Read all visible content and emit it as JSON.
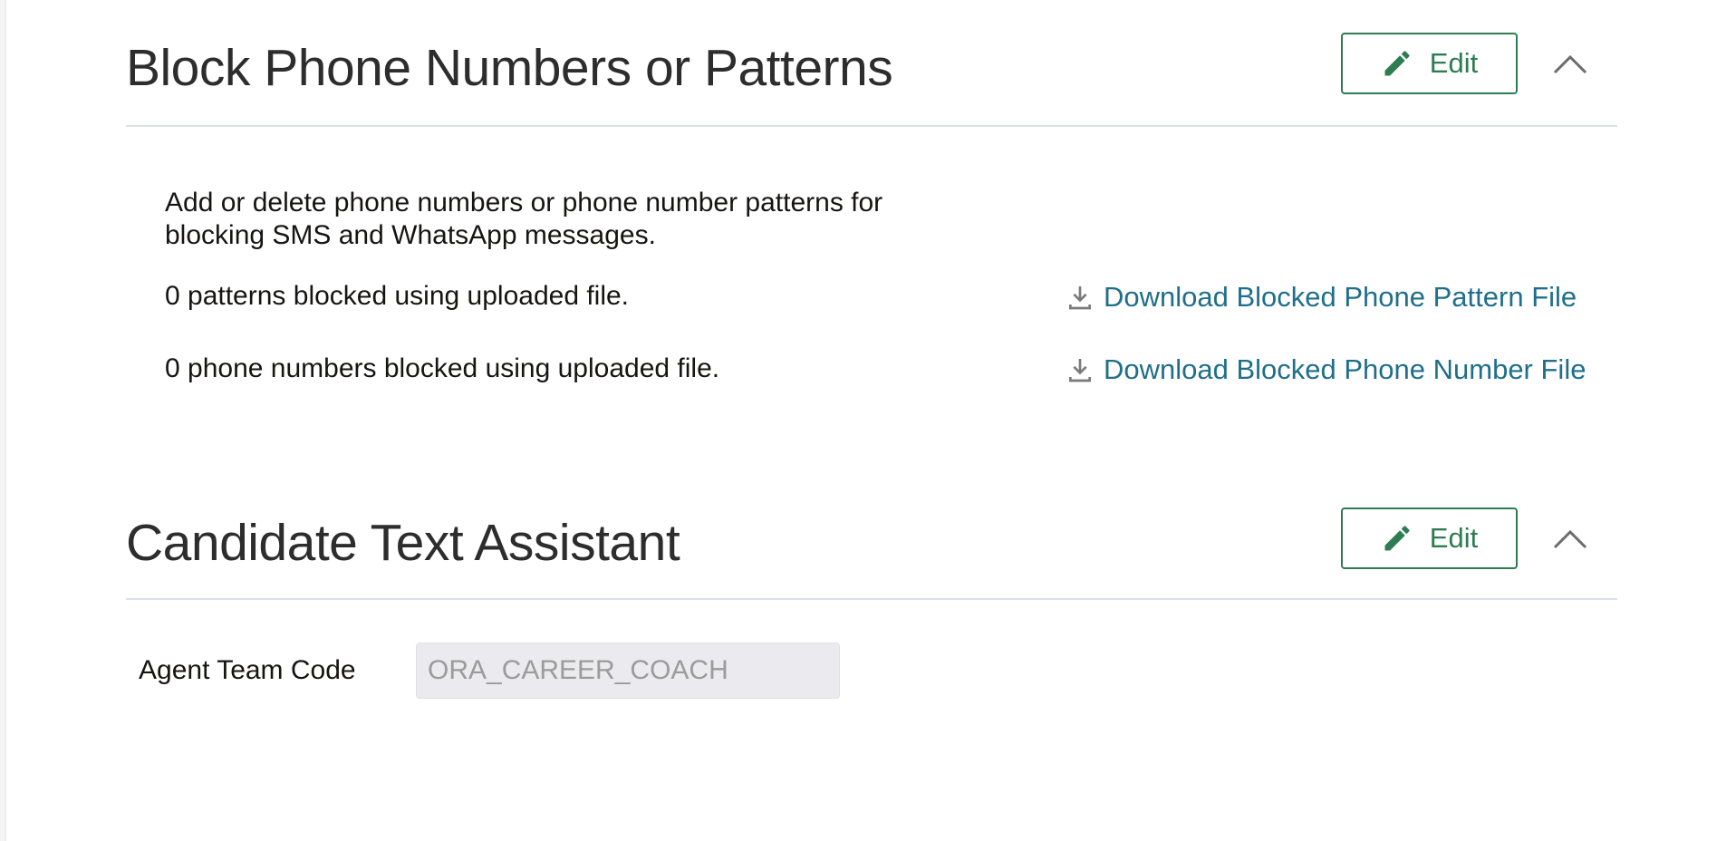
{
  "sections": {
    "block": {
      "title": "Block Phone Numbers or Patterns",
      "edit_label": "Edit",
      "description_line1": "Add or delete phone numbers or phone number patterns for",
      "description_line2": "blocking SMS and WhatsApp messages.",
      "patterns_status": "0 patterns blocked using uploaded file.",
      "numbers_status": "0 phone numbers blocked using uploaded file.",
      "download_pattern_label": "Download Blocked Phone Pattern File",
      "download_number_label": "Download Blocked Phone Number File"
    },
    "assistant": {
      "title": "Candidate Text Assistant",
      "edit_label": "Edit",
      "agent_team_code_label": "Agent Team Code",
      "agent_team_code_value": "ORA_CAREER_COACH"
    }
  },
  "icons": {
    "edit": "pencil-icon",
    "collapse": "chevron-up-icon",
    "download": "download-icon"
  },
  "colors": {
    "accent_green": "#2e7d52",
    "link_blue": "#1f6f8b",
    "divider": "#dbe3e6",
    "readonly_bg": "#ebebef"
  }
}
